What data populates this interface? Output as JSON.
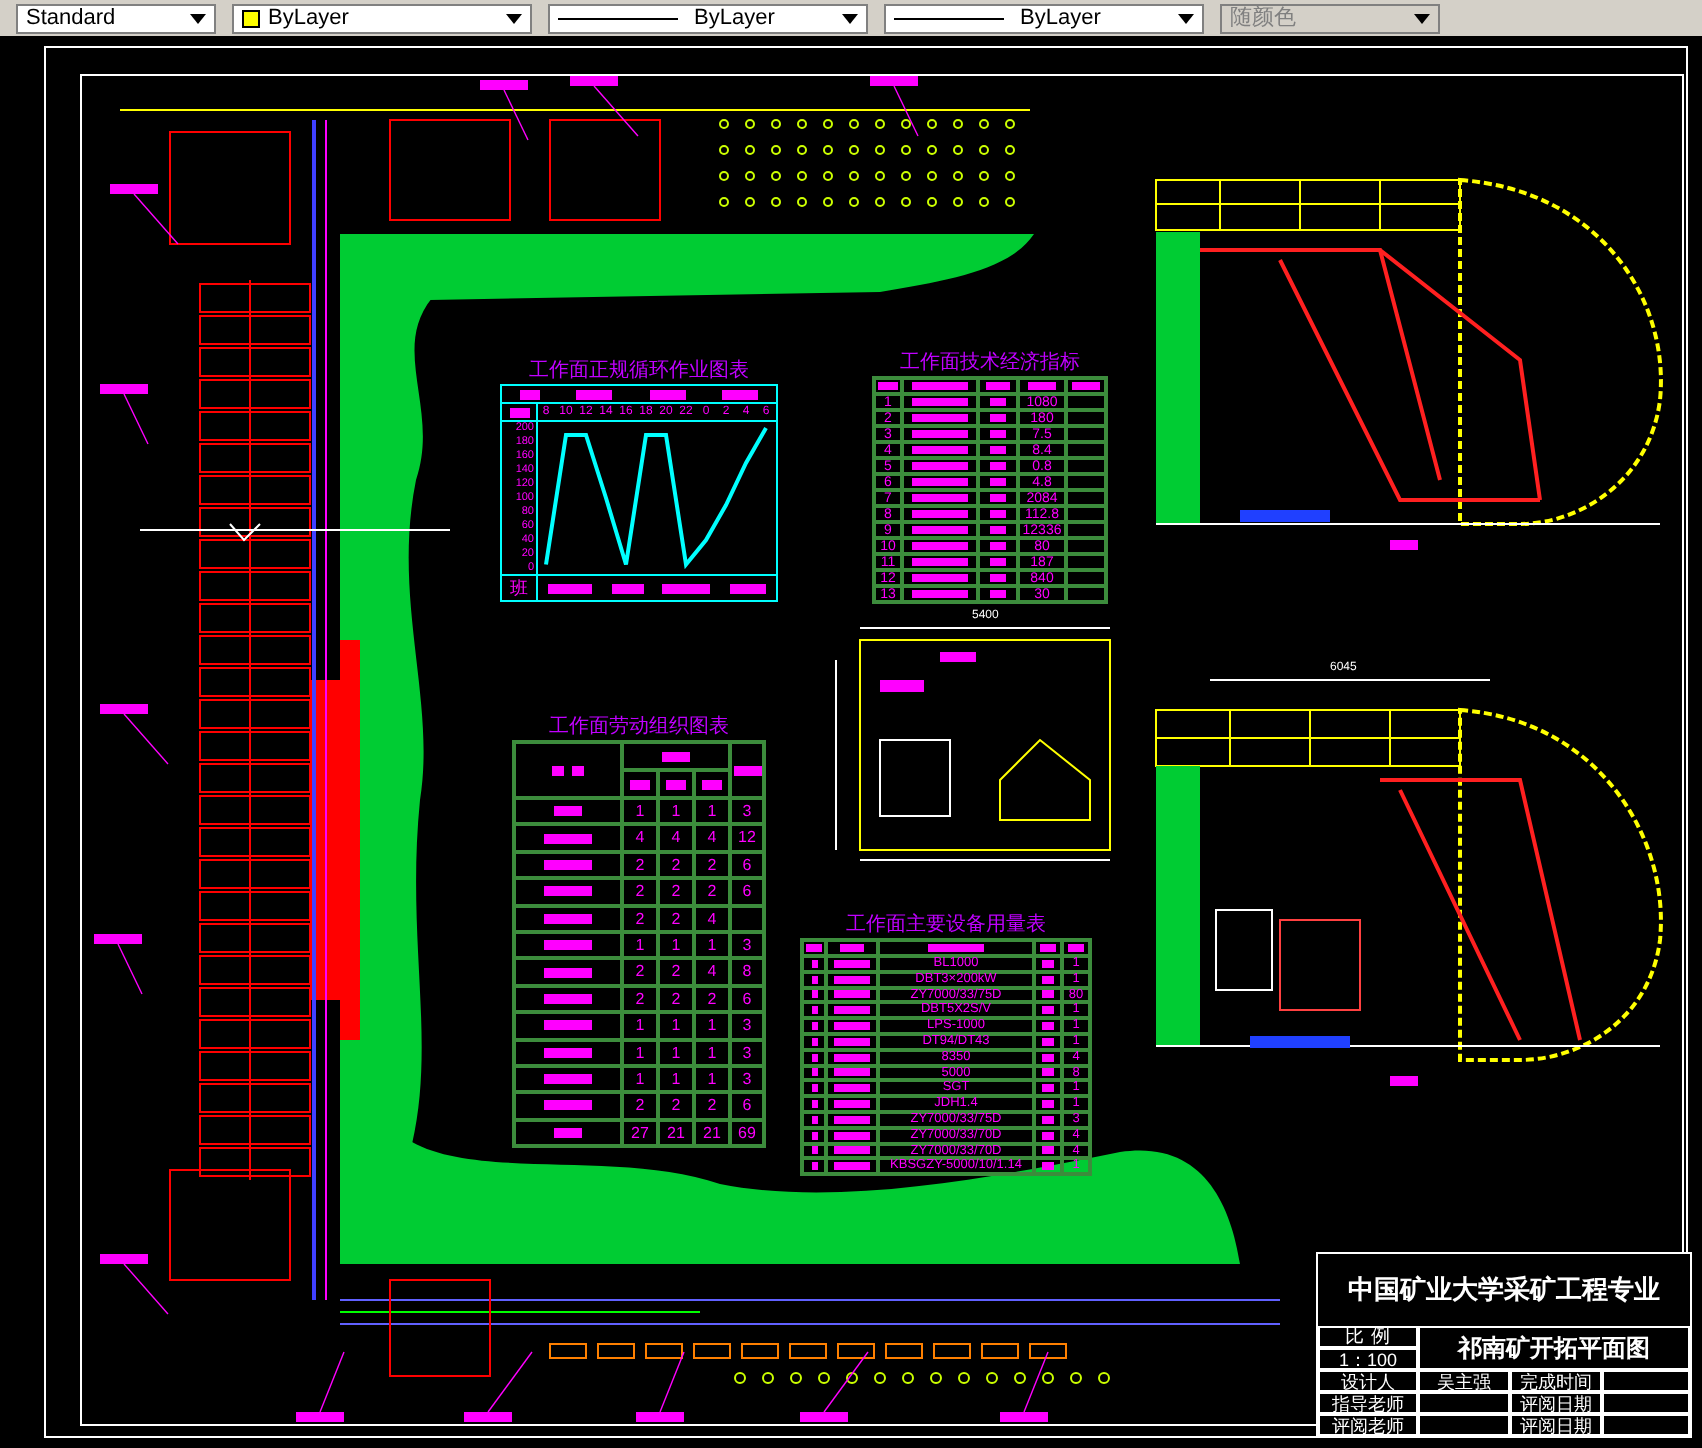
{
  "toolbar": {
    "text_style": "Standard",
    "layer_color": "ByLayer",
    "linetype": "ByLayer",
    "lineweight": "ByLayer",
    "plot_style": {
      "value": "随颜色",
      "disabled": true
    }
  },
  "cycle_chart": {
    "footer_label": "班",
    "chart_data": {
      "type": "line",
      "title": "工作面正规循环作业图表",
      "categories": [
        "8",
        "10",
        "12",
        "14",
        "16",
        "18",
        "20",
        "22",
        "0",
        "2",
        "4",
        "6"
      ],
      "yticks": [
        200,
        180,
        160,
        140,
        120,
        100,
        80,
        60,
        40,
        20,
        0
      ],
      "ylim": [
        0,
        200
      ],
      "series": [
        {
          "color": "#00ffff",
          "values": [
            5,
            190,
            190,
            100,
            5,
            190,
            190,
            5,
            40,
            90,
            150,
            200
          ]
        }
      ]
    }
  },
  "tech_table": {
    "title": "工作面技术经济指标",
    "rows": [
      {
        "no": "1",
        "value": "1080"
      },
      {
        "no": "2",
        "value": "180"
      },
      {
        "no": "3",
        "value": "7.5"
      },
      {
        "no": "4",
        "value": "8.4"
      },
      {
        "no": "5",
        "value": "0.8"
      },
      {
        "no": "6",
        "value": "4.8"
      },
      {
        "no": "7",
        "value": "2084"
      },
      {
        "no": "8",
        "value": "112.8"
      },
      {
        "no": "9",
        "value": "12336"
      },
      {
        "no": "10",
        "value": "80"
      },
      {
        "no": "11",
        "value": "187"
      },
      {
        "no": "12",
        "value": "840"
      },
      {
        "no": "13",
        "value": "30"
      }
    ]
  },
  "labour_table": {
    "title": "工作面劳动组织图表",
    "rows": [
      [
        "1",
        "1",
        "1",
        "3"
      ],
      [
        "4",
        "4",
        "4",
        "12"
      ],
      [
        "2",
        "2",
        "2",
        "6"
      ],
      [
        "2",
        "2",
        "2",
        "6"
      ],
      [
        "2",
        "2",
        "4"
      ],
      [
        "1",
        "1",
        "1",
        "3"
      ],
      [
        "2",
        "2",
        "4",
        "8"
      ],
      [
        "2",
        "2",
        "2",
        "6"
      ],
      [
        "1",
        "1",
        "1",
        "3"
      ],
      [
        "1",
        "1",
        "1",
        "3"
      ],
      [
        "1",
        "1",
        "1",
        "3"
      ],
      [
        "2",
        "2",
        "2",
        "6"
      ],
      [
        "27",
        "21",
        "21",
        "69"
      ]
    ]
  },
  "equipment_table": {
    "title": "工作面主要设备用量表",
    "rows": [
      {
        "model": "BL1000",
        "quantity": "1"
      },
      {
        "model": "DBT3×200kW",
        "quantity": "1"
      },
      {
        "model": "ZY7000/33/75D",
        "quantity": "80"
      },
      {
        "model": "DBT5X2S/V",
        "quantity": "1"
      },
      {
        "model": "LPS-1000",
        "quantity": "1"
      },
      {
        "model": "DT94/DT43",
        "quantity": "1"
      },
      {
        "model": "8350",
        "quantity": "4"
      },
      {
        "model": "5000",
        "quantity": "8"
      },
      {
        "model": "SGT",
        "quantity": "1"
      },
      {
        "model": "JDH1.4",
        "quantity": "1"
      },
      {
        "model": "ZY7000/33/75D",
        "quantity": "3"
      },
      {
        "model": "ZY7000/33/70D",
        "quantity": "4"
      },
      {
        "model": "ZY7000/33/70D",
        "quantity": "4"
      },
      {
        "model": "KBSGZY-5000/10/1.14",
        "quantity": "1"
      }
    ]
  },
  "dimension_labels": [
    "5400",
    "6045"
  ],
  "title_block": {
    "school": "中国矿业大学采矿工程专业",
    "scale_label": "比 例",
    "scale": "1：100",
    "drawing_title": "祁南矿开拓平面图",
    "rows": [
      {
        "label": "设计人",
        "value": "吴主强",
        "label_2": "完成时间"
      },
      {
        "label": "指导老师",
        "label_2": "评阅日期"
      },
      {
        "label": "评阅老师",
        "label_2": "评阅日期"
      }
    ]
  }
}
